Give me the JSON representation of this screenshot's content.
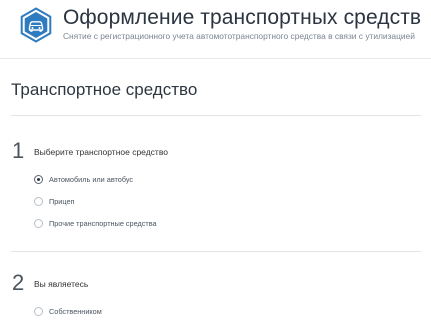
{
  "header": {
    "icon": "car-in-hexagon-icon",
    "accent": "#2f7bbf",
    "title": "Оформление транспортных средств",
    "subtitle": "Снятие с регистрационного учета автомототранспортного средства в связи с утилизацией"
  },
  "section": {
    "title": "Транспортное средство"
  },
  "steps": [
    {
      "number": "1",
      "label": "Выберите транспортное средство",
      "options": [
        {
          "label": "Автомобиль или автобус",
          "checked": true
        },
        {
          "label": "Прицеп",
          "checked": false
        },
        {
          "label": "Прочие транспортные средства",
          "checked": false
        }
      ]
    },
    {
      "number": "2",
      "label": "Вы являетесь",
      "options": [
        {
          "label": "Собственником",
          "checked": false
        }
      ]
    }
  ]
}
